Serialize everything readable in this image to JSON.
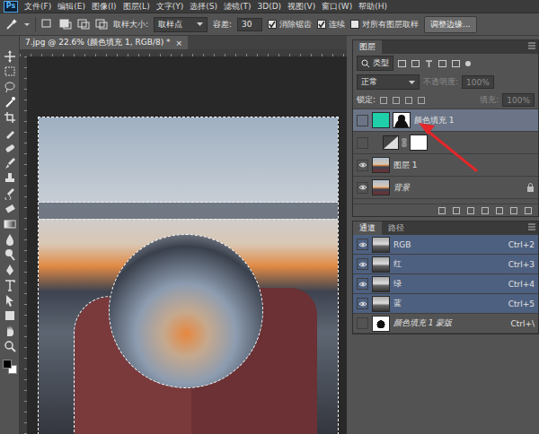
{
  "app": {
    "logo": "Ps"
  },
  "menu": [
    "文件(F)",
    "编辑(E)",
    "图像(I)",
    "图层(L)",
    "文字(Y)",
    "选择(S)",
    "滤镜(T)",
    "3D(D)",
    "视图(V)",
    "窗口(W)",
    "帮助(H)"
  ],
  "options": {
    "sample_label": "取样大小:",
    "sample_value": "取样点",
    "tolerance_label": "容差:",
    "tolerance": "30",
    "checks": [
      {
        "label": "消除锯齿",
        "checked": true
      },
      {
        "label": "连续",
        "checked": true
      },
      {
        "label": "对所有图层取样",
        "checked": false
      }
    ],
    "refine_button": "调整边缘..."
  },
  "document": {
    "tab_title": "7.jpg @ 22.6% (颜色填充 1, RGB/8) *",
    "close": "×"
  },
  "colors": {
    "foreground": "#000000",
    "background": "#ffffff"
  },
  "layers_panel": {
    "title": "图层",
    "filter_kind": "类型",
    "blend_mode": "正常",
    "opacity_label": "不透明度:",
    "opacity": "100%",
    "opacity_disabled": true,
    "lock_label": "锁定:",
    "fill_label": "填充:",
    "fill": "100%",
    "fill_disabled": true,
    "layers": [
      {
        "name": "颜色填充 1",
        "kind": "fill",
        "visible": false,
        "selected": true,
        "color": "#1fcfa9"
      },
      {
        "kind": "adjustment",
        "visible": false,
        "selected": false
      },
      {
        "name": "图层 1",
        "kind": "pixel",
        "visible": true,
        "selected": false
      },
      {
        "name": "背景",
        "kind": "background",
        "visible": true,
        "selected": false,
        "locked": true
      }
    ]
  },
  "channels_panel": {
    "tabs": [
      {
        "label": "通道",
        "selected": true
      },
      {
        "label": "路径",
        "selected": false
      }
    ],
    "channels": [
      {
        "name": "RGB",
        "shortcut": "Ctrl+2",
        "kind": "composite",
        "visible": true,
        "selected": true
      },
      {
        "name": "红",
        "shortcut": "Ctrl+3",
        "kind": "color",
        "visible": true,
        "selected": true
      },
      {
        "name": "绿",
        "shortcut": "Ctrl+4",
        "kind": "color",
        "visible": true,
        "selected": true
      },
      {
        "name": "蓝",
        "shortcut": "Ctrl+5",
        "kind": "color",
        "visible": true,
        "selected": true
      },
      {
        "name": "颜色填充 1 蒙版",
        "shortcut": "Ctrl+\\",
        "kind": "mask",
        "visible": false,
        "selected": false
      }
    ]
  }
}
